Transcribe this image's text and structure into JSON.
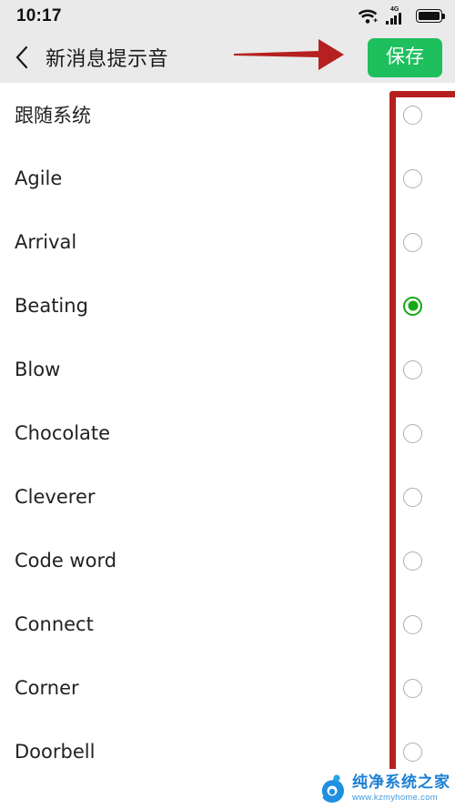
{
  "status_bar": {
    "time": "10:17",
    "wifi_icon": "wifi-icon",
    "signal_icon": "signal-icon",
    "signal_label": "4G",
    "battery_icon": "battery-icon"
  },
  "app_bar": {
    "back_icon": "back-chevron-icon",
    "title": "新消息提示音",
    "save_label": "保存",
    "save_color": "#1ec05e"
  },
  "list": {
    "selected_index": 3,
    "rows": [
      {
        "label": "跟随系统",
        "selected": false
      },
      {
        "label": "Agile",
        "selected": false
      },
      {
        "label": "Arrival",
        "selected": false
      },
      {
        "label": "Beating",
        "selected": true
      },
      {
        "label": "Blow",
        "selected": false
      },
      {
        "label": "Chocolate",
        "selected": false
      },
      {
        "label": "Cleverer",
        "selected": false
      },
      {
        "label": "Code word",
        "selected": false
      },
      {
        "label": "Connect",
        "selected": false
      },
      {
        "label": "Corner",
        "selected": false
      },
      {
        "label": "Doorbell",
        "selected": false
      }
    ]
  },
  "annotations": {
    "arrow_color": "#b62020",
    "rect_color": "#b62020",
    "arrow_name": "red-arrow-annotation",
    "rect_name": "red-rectangle-annotation"
  },
  "watermark": {
    "name_cn": "纯净系统之家",
    "url": "www.kzmyhome.com",
    "logo_color": "#1a7fd4"
  }
}
